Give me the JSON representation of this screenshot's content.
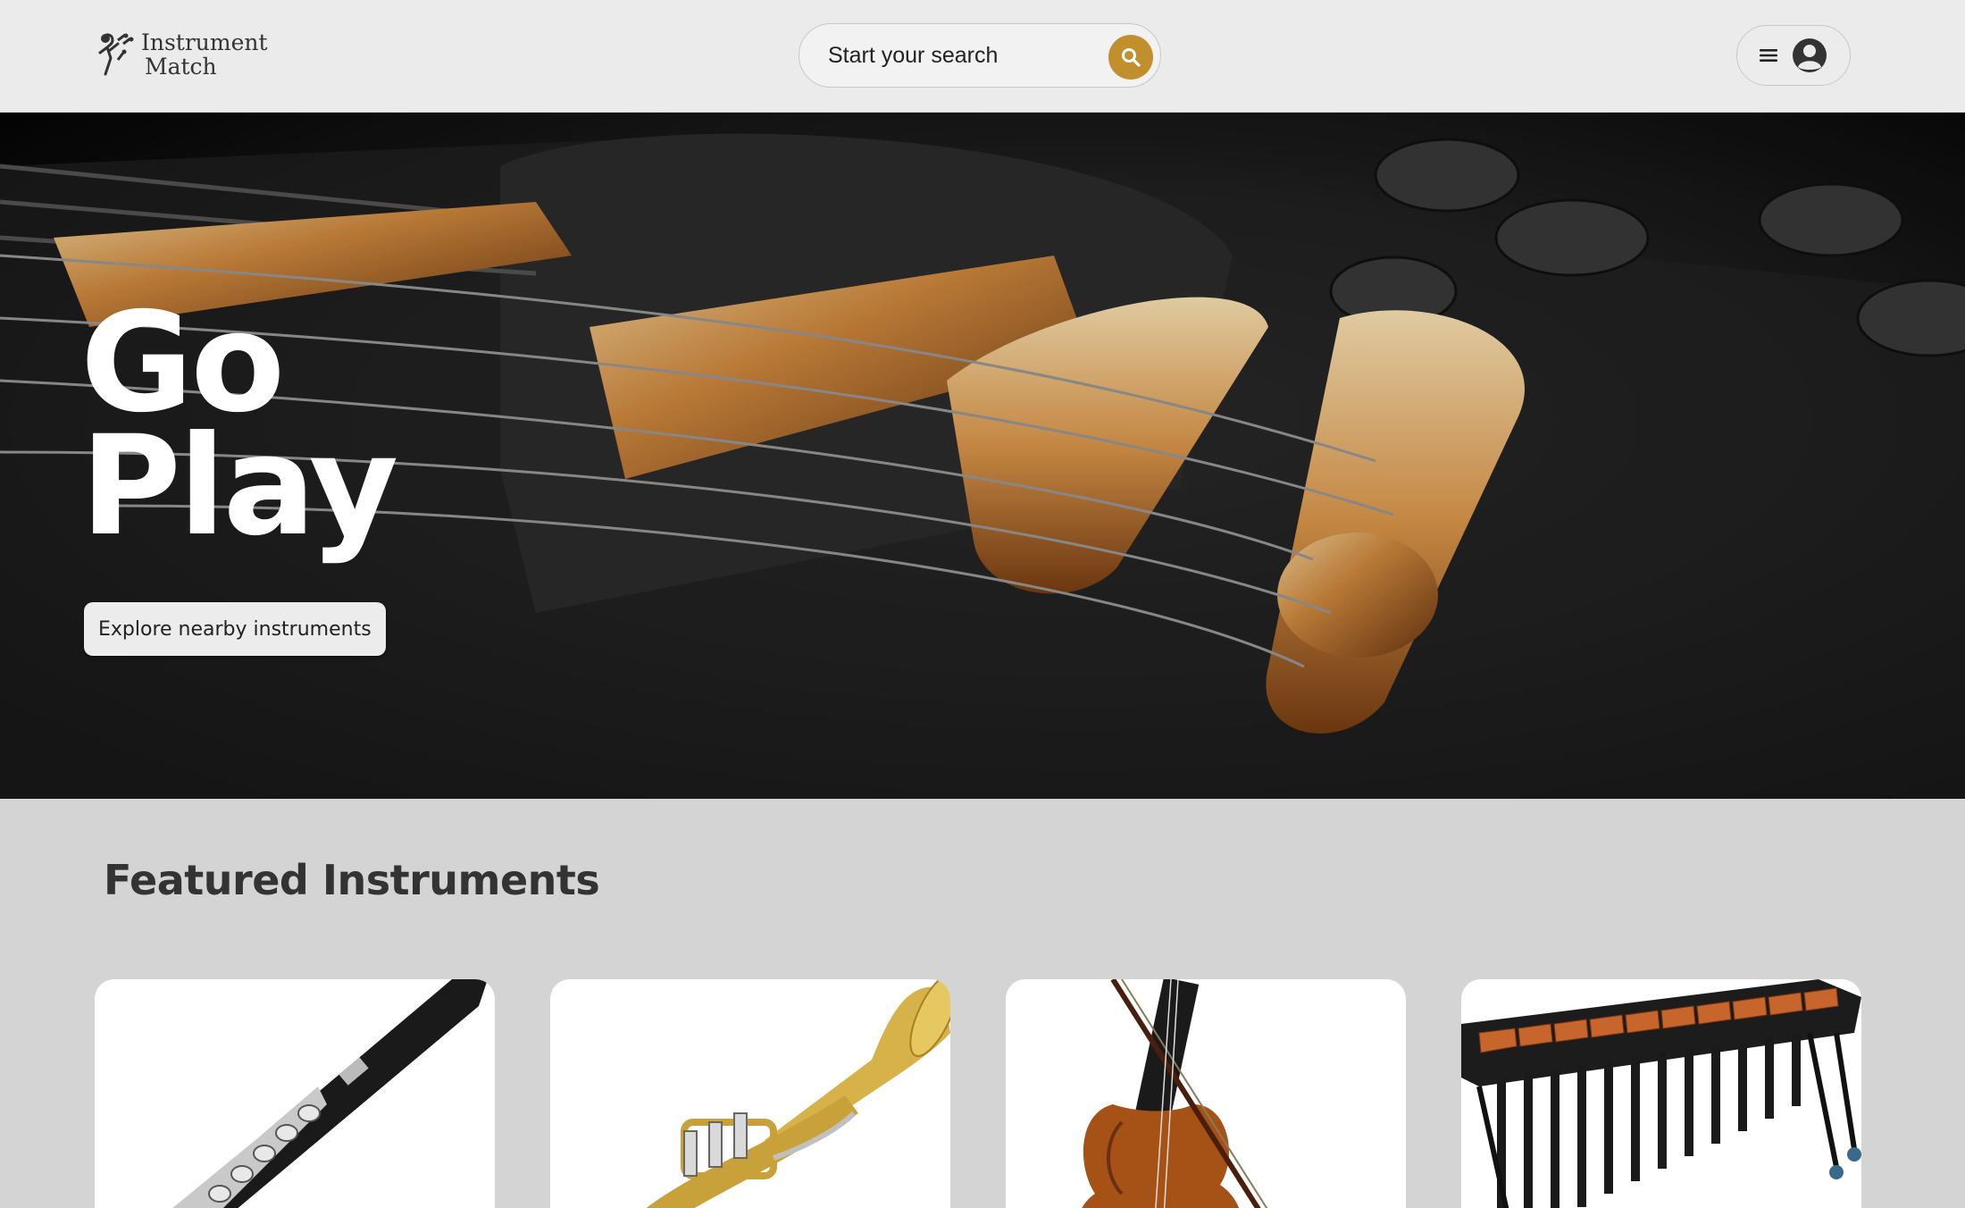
{
  "header": {
    "logo_line1": "Instrument",
    "logo_line2": "Match",
    "search_placeholder": "Start your search",
    "search_icon": "search-icon",
    "menu_icon": "hamburger-menu-icon",
    "profile_icon": "user-avatar-icon"
  },
  "hero": {
    "title_line1": "Go",
    "title_line2": "Play",
    "cta_label": "Explore nearby instruments"
  },
  "featured": {
    "title": "Featured Instruments",
    "items": [
      {
        "image": "flute-image"
      },
      {
        "image": "trumpet-image"
      },
      {
        "image": "violin-image"
      },
      {
        "image": "marimba-image"
      }
    ]
  },
  "colors": {
    "accent": "#c18f2c",
    "header_bg": "#ebebeb",
    "page_bg": "#d4d4d4"
  }
}
